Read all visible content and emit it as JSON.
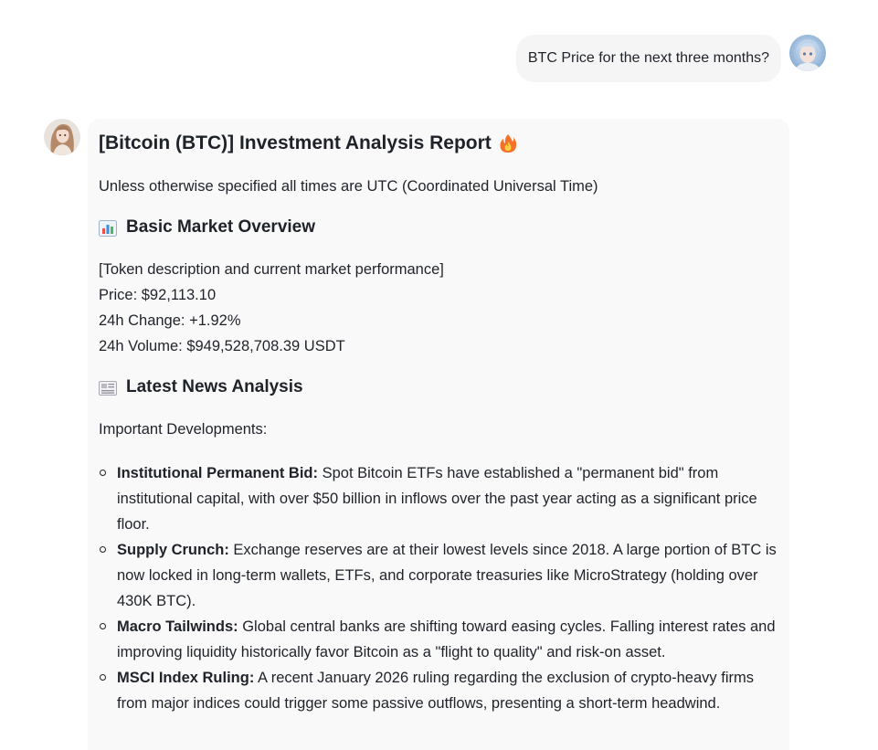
{
  "user_message": {
    "text": "BTC Price for the next three months?"
  },
  "assistant_message": {
    "title": "[Bitcoin (BTC)] Investment Analysis Report",
    "title_emoji": "fire-icon",
    "subtitle": "Unless otherwise specified all times are UTC (Coordinated Universal Time)",
    "market_overview": {
      "heading": "Basic Market Overview",
      "icon": "bar-chart-icon",
      "description": "[Token description and current market performance]",
      "price": "Price: $92,113.10",
      "change_24h": "24h Change: +1.92%",
      "volume_24h": "24h Volume: $949,528,708.39 USDT"
    },
    "news": {
      "heading": "Latest News Analysis",
      "icon": "newspaper-icon",
      "intro": "Important Developments:",
      "items": [
        {
          "label": "Institutional Permanent Bid:",
          "text": " Spot Bitcoin ETFs have established a \"permanent bid\" from institutional capital, with over $50 billion in inflows over the past year acting as a significant price floor."
        },
        {
          "label": "Supply Crunch:",
          "text": " Exchange reserves are at their lowest levels since 2018. A large portion of BTC is now locked in long-term wallets, ETFs, and corporate treasuries like MicroStrategy (holding over 430K BTC)."
        },
        {
          "label": "Macro Tailwinds:",
          "text": " Global central banks are shifting toward easing cycles. Falling interest rates and improving liquidity historically favor Bitcoin as a \"flight to quality\" and risk-on asset."
        },
        {
          "label": "MSCI Index Ruling:",
          "text": " A recent January 2026 ruling regarding the exclusion of crypto-heavy firms from major indices could trigger some passive outflows, presenting a short-term headwind."
        }
      ]
    }
  },
  "colors": {
    "card_background": "#f9f9f9",
    "bubble_background": "#f5f5f5",
    "text": "#1f2329"
  }
}
